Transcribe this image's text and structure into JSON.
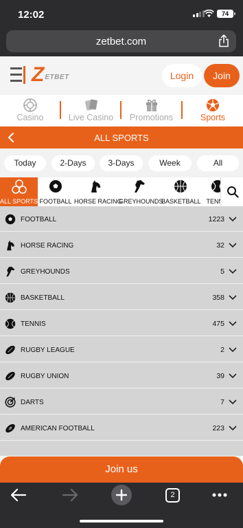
{
  "status": {
    "time": "12:02",
    "battery": "74"
  },
  "browser": {
    "url": "zetbet.com",
    "tab_count": "2"
  },
  "header": {
    "logo_mark": "Z",
    "logo_text": "ETBET",
    "login_label": "Login",
    "join_label": "Join"
  },
  "categories": [
    {
      "label": "Casino",
      "icon": "casino-chip-icon",
      "active": false
    },
    {
      "label": "Live Casino",
      "icon": "cards-icon",
      "active": false
    },
    {
      "label": "Promotions",
      "icon": "gift-icon",
      "active": false
    },
    {
      "label": "Sports",
      "icon": "soccer-ball-icon",
      "active": true
    }
  ],
  "sports_bar": {
    "title": "ALL SPORTS"
  },
  "periods": [
    "Today",
    "2-Days",
    "3-Days",
    "Week",
    "All"
  ],
  "sport_tabs": [
    {
      "label": "ALL SPORTS",
      "icon": "all-sports-icon",
      "active": true
    },
    {
      "label": "FOOTBALL",
      "icon": "football-icon"
    },
    {
      "label": "HORSE RACING",
      "icon": "horse-icon"
    },
    {
      "label": "GREYHOUNDS",
      "icon": "greyhound-icon"
    },
    {
      "label": "BASKETBALL",
      "icon": "basketball-icon"
    },
    {
      "label": "TENNIS",
      "icon": "tennis-icon"
    }
  ],
  "sports": [
    {
      "name": "FOOTBALL",
      "count": "1223",
      "icon": "football-icon"
    },
    {
      "name": "HORSE RACING",
      "count": "32",
      "icon": "horse-icon"
    },
    {
      "name": "GREYHOUNDS",
      "count": "5",
      "icon": "greyhound-icon"
    },
    {
      "name": "BASKETBALL",
      "count": "358",
      "icon": "basketball-icon"
    },
    {
      "name": "TENNIS",
      "count": "475",
      "icon": "tennis-icon"
    },
    {
      "name": "RUGBY LEAGUE",
      "count": "2",
      "icon": "rugby-ball-icon"
    },
    {
      "name": "RUGBY UNION",
      "count": "39",
      "icon": "rugby-ball-icon"
    },
    {
      "name": "DARTS",
      "count": "7",
      "icon": "dartboard-icon"
    },
    {
      "name": "AMERICAN FOOTBALL",
      "count": "223",
      "icon": "american-football-icon"
    }
  ],
  "join_us": {
    "label": "Join us"
  },
  "colors": {
    "accent": "#e8611b",
    "list_bg": "#d4d4d4",
    "browser_chrome": "#2c2c2e"
  }
}
